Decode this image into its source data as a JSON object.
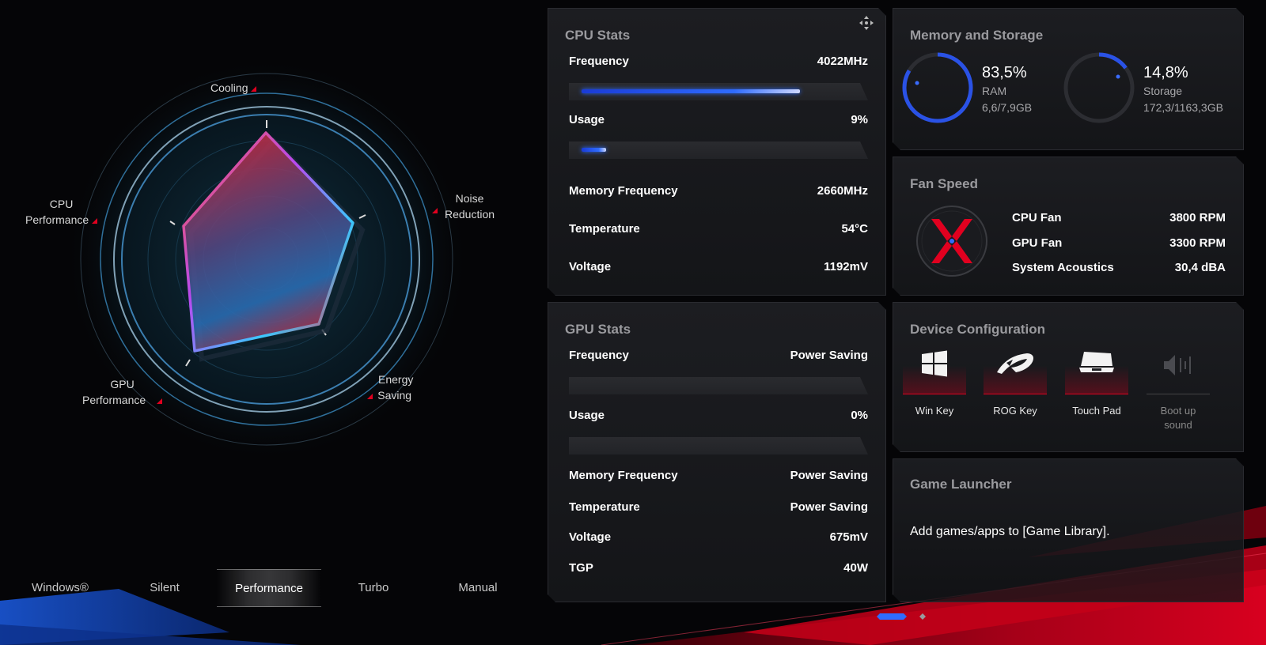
{
  "radar": {
    "labels": {
      "cooling": "Cooling",
      "noise": [
        "Noise",
        "Reduction"
      ],
      "cpu": [
        "CPU",
        "Performance"
      ],
      "gpu": [
        "GPU",
        "Performance"
      ],
      "energy": [
        "Energy",
        "Saving"
      ]
    }
  },
  "modes": {
    "items": [
      "Windows®",
      "Silent",
      "Performance",
      "Turbo",
      "Manual"
    ],
    "active": "Performance"
  },
  "cpu_stats": {
    "title": "CPU Stats",
    "frequency_label": "Frequency",
    "frequency_value": "4022MHz",
    "frequency_fill": 0.8,
    "usage_label": "Usage",
    "usage_value": "9%",
    "usage_fill": 0.09,
    "mem_freq_label": "Memory Frequency",
    "mem_freq_value": "2660MHz",
    "temp_label": "Temperature",
    "temp_value": "54°C",
    "voltage_label": "Voltage",
    "voltage_value": "1192mV"
  },
  "gpu_stats": {
    "title": "GPU Stats",
    "frequency_label": "Frequency",
    "frequency_value": "Power Saving",
    "usage_label": "Usage",
    "usage_value": "0%",
    "mem_freq_label": "Memory Frequency",
    "mem_freq_value": "Power Saving",
    "temp_label": "Temperature",
    "temp_value": "Power Saving",
    "voltage_label": "Voltage",
    "voltage_value": "675mV",
    "tgp_label": "TGP",
    "tgp_value": "40W"
  },
  "memory": {
    "title": "Memory and Storage",
    "ram_percent": "83,5%",
    "ram_label": "RAM",
    "ram_detail": "6,6/7,9GB",
    "ram_fraction": 0.835,
    "storage_percent": "14,8%",
    "storage_label": "Storage",
    "storage_detail": "172,3/1163,3GB",
    "storage_fraction": 0.148
  },
  "fan": {
    "title": "Fan Speed",
    "cpu_label": "CPU Fan",
    "cpu_value": "3800 RPM",
    "gpu_label": "GPU Fan",
    "gpu_value": "3300 RPM",
    "acoustics_label": "System Acoustics",
    "acoustics_value": "30,4 dBA"
  },
  "device": {
    "title": "Device Configuration",
    "items": [
      {
        "label": "Win Key",
        "icon": "windows-icon"
      },
      {
        "label": "ROG Key",
        "icon": "rog-icon"
      },
      {
        "label": "Touch Pad",
        "icon": "touchpad-icon"
      },
      {
        "label": "Boot up sound",
        "icon": "sound-icon"
      }
    ]
  },
  "launcher": {
    "title": "Game Launcher",
    "text": "Add games/apps to [Game Library]."
  },
  "colors": {
    "accent_red": "#e1001f",
    "accent_blue": "#2f6cff"
  }
}
